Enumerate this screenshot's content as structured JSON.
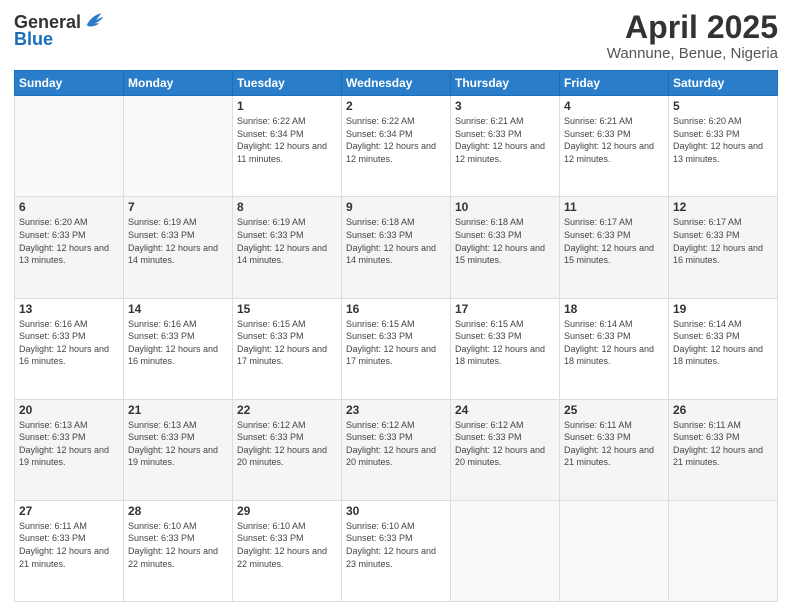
{
  "logo": {
    "general": "General",
    "blue": "Blue"
  },
  "header": {
    "title": "April 2025",
    "subtitle": "Wannune, Benue, Nigeria"
  },
  "weekdays": [
    "Sunday",
    "Monday",
    "Tuesday",
    "Wednesday",
    "Thursday",
    "Friday",
    "Saturday"
  ],
  "weeks": [
    [
      {
        "day": "",
        "info": ""
      },
      {
        "day": "",
        "info": ""
      },
      {
        "day": "1",
        "info": "Sunrise: 6:22 AM\nSunset: 6:34 PM\nDaylight: 12 hours and 11 minutes."
      },
      {
        "day": "2",
        "info": "Sunrise: 6:22 AM\nSunset: 6:34 PM\nDaylight: 12 hours and 12 minutes."
      },
      {
        "day": "3",
        "info": "Sunrise: 6:21 AM\nSunset: 6:33 PM\nDaylight: 12 hours and 12 minutes."
      },
      {
        "day": "4",
        "info": "Sunrise: 6:21 AM\nSunset: 6:33 PM\nDaylight: 12 hours and 12 minutes."
      },
      {
        "day": "5",
        "info": "Sunrise: 6:20 AM\nSunset: 6:33 PM\nDaylight: 12 hours and 13 minutes."
      }
    ],
    [
      {
        "day": "6",
        "info": "Sunrise: 6:20 AM\nSunset: 6:33 PM\nDaylight: 12 hours and 13 minutes."
      },
      {
        "day": "7",
        "info": "Sunrise: 6:19 AM\nSunset: 6:33 PM\nDaylight: 12 hours and 14 minutes."
      },
      {
        "day": "8",
        "info": "Sunrise: 6:19 AM\nSunset: 6:33 PM\nDaylight: 12 hours and 14 minutes."
      },
      {
        "day": "9",
        "info": "Sunrise: 6:18 AM\nSunset: 6:33 PM\nDaylight: 12 hours and 14 minutes."
      },
      {
        "day": "10",
        "info": "Sunrise: 6:18 AM\nSunset: 6:33 PM\nDaylight: 12 hours and 15 minutes."
      },
      {
        "day": "11",
        "info": "Sunrise: 6:17 AM\nSunset: 6:33 PM\nDaylight: 12 hours and 15 minutes."
      },
      {
        "day": "12",
        "info": "Sunrise: 6:17 AM\nSunset: 6:33 PM\nDaylight: 12 hours and 16 minutes."
      }
    ],
    [
      {
        "day": "13",
        "info": "Sunrise: 6:16 AM\nSunset: 6:33 PM\nDaylight: 12 hours and 16 minutes."
      },
      {
        "day": "14",
        "info": "Sunrise: 6:16 AM\nSunset: 6:33 PM\nDaylight: 12 hours and 16 minutes."
      },
      {
        "day": "15",
        "info": "Sunrise: 6:15 AM\nSunset: 6:33 PM\nDaylight: 12 hours and 17 minutes."
      },
      {
        "day": "16",
        "info": "Sunrise: 6:15 AM\nSunset: 6:33 PM\nDaylight: 12 hours and 17 minutes."
      },
      {
        "day": "17",
        "info": "Sunrise: 6:15 AM\nSunset: 6:33 PM\nDaylight: 12 hours and 18 minutes."
      },
      {
        "day": "18",
        "info": "Sunrise: 6:14 AM\nSunset: 6:33 PM\nDaylight: 12 hours and 18 minutes."
      },
      {
        "day": "19",
        "info": "Sunrise: 6:14 AM\nSunset: 6:33 PM\nDaylight: 12 hours and 18 minutes."
      }
    ],
    [
      {
        "day": "20",
        "info": "Sunrise: 6:13 AM\nSunset: 6:33 PM\nDaylight: 12 hours and 19 minutes."
      },
      {
        "day": "21",
        "info": "Sunrise: 6:13 AM\nSunset: 6:33 PM\nDaylight: 12 hours and 19 minutes."
      },
      {
        "day": "22",
        "info": "Sunrise: 6:12 AM\nSunset: 6:33 PM\nDaylight: 12 hours and 20 minutes."
      },
      {
        "day": "23",
        "info": "Sunrise: 6:12 AM\nSunset: 6:33 PM\nDaylight: 12 hours and 20 minutes."
      },
      {
        "day": "24",
        "info": "Sunrise: 6:12 AM\nSunset: 6:33 PM\nDaylight: 12 hours and 20 minutes."
      },
      {
        "day": "25",
        "info": "Sunrise: 6:11 AM\nSunset: 6:33 PM\nDaylight: 12 hours and 21 minutes."
      },
      {
        "day": "26",
        "info": "Sunrise: 6:11 AM\nSunset: 6:33 PM\nDaylight: 12 hours and 21 minutes."
      }
    ],
    [
      {
        "day": "27",
        "info": "Sunrise: 6:11 AM\nSunset: 6:33 PM\nDaylight: 12 hours and 21 minutes."
      },
      {
        "day": "28",
        "info": "Sunrise: 6:10 AM\nSunset: 6:33 PM\nDaylight: 12 hours and 22 minutes."
      },
      {
        "day": "29",
        "info": "Sunrise: 6:10 AM\nSunset: 6:33 PM\nDaylight: 12 hours and 22 minutes."
      },
      {
        "day": "30",
        "info": "Sunrise: 6:10 AM\nSunset: 6:33 PM\nDaylight: 12 hours and 23 minutes."
      },
      {
        "day": "",
        "info": ""
      },
      {
        "day": "",
        "info": ""
      },
      {
        "day": "",
        "info": ""
      }
    ]
  ]
}
